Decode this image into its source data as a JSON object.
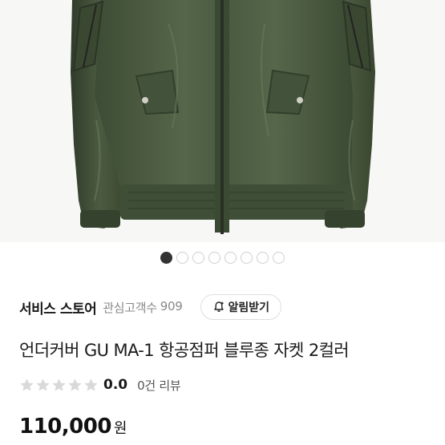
{
  "product_image": {
    "alt": "",
    "colors": {
      "jacket": "#4a5a40",
      "jacket_shadow": "#34412e",
      "background": "#f7f7f6"
    }
  },
  "pager": {
    "count": 8,
    "active_index": 0
  },
  "store": {
    "name": "서비스 스토어",
    "followers_label": "관심고객수",
    "followers_count": "909",
    "notify_label": "알림받기",
    "notify_icon": "bell-plus-icon"
  },
  "product": {
    "title": "언더커버 GU MA-1 항공점퍼 블루종 자켓 2컬러",
    "rating_score": "0.0",
    "rating_stars_filled": 0,
    "rating_stars_total": 5,
    "review_label": "0건 리뷰",
    "price": "110,000",
    "currency": "원"
  }
}
